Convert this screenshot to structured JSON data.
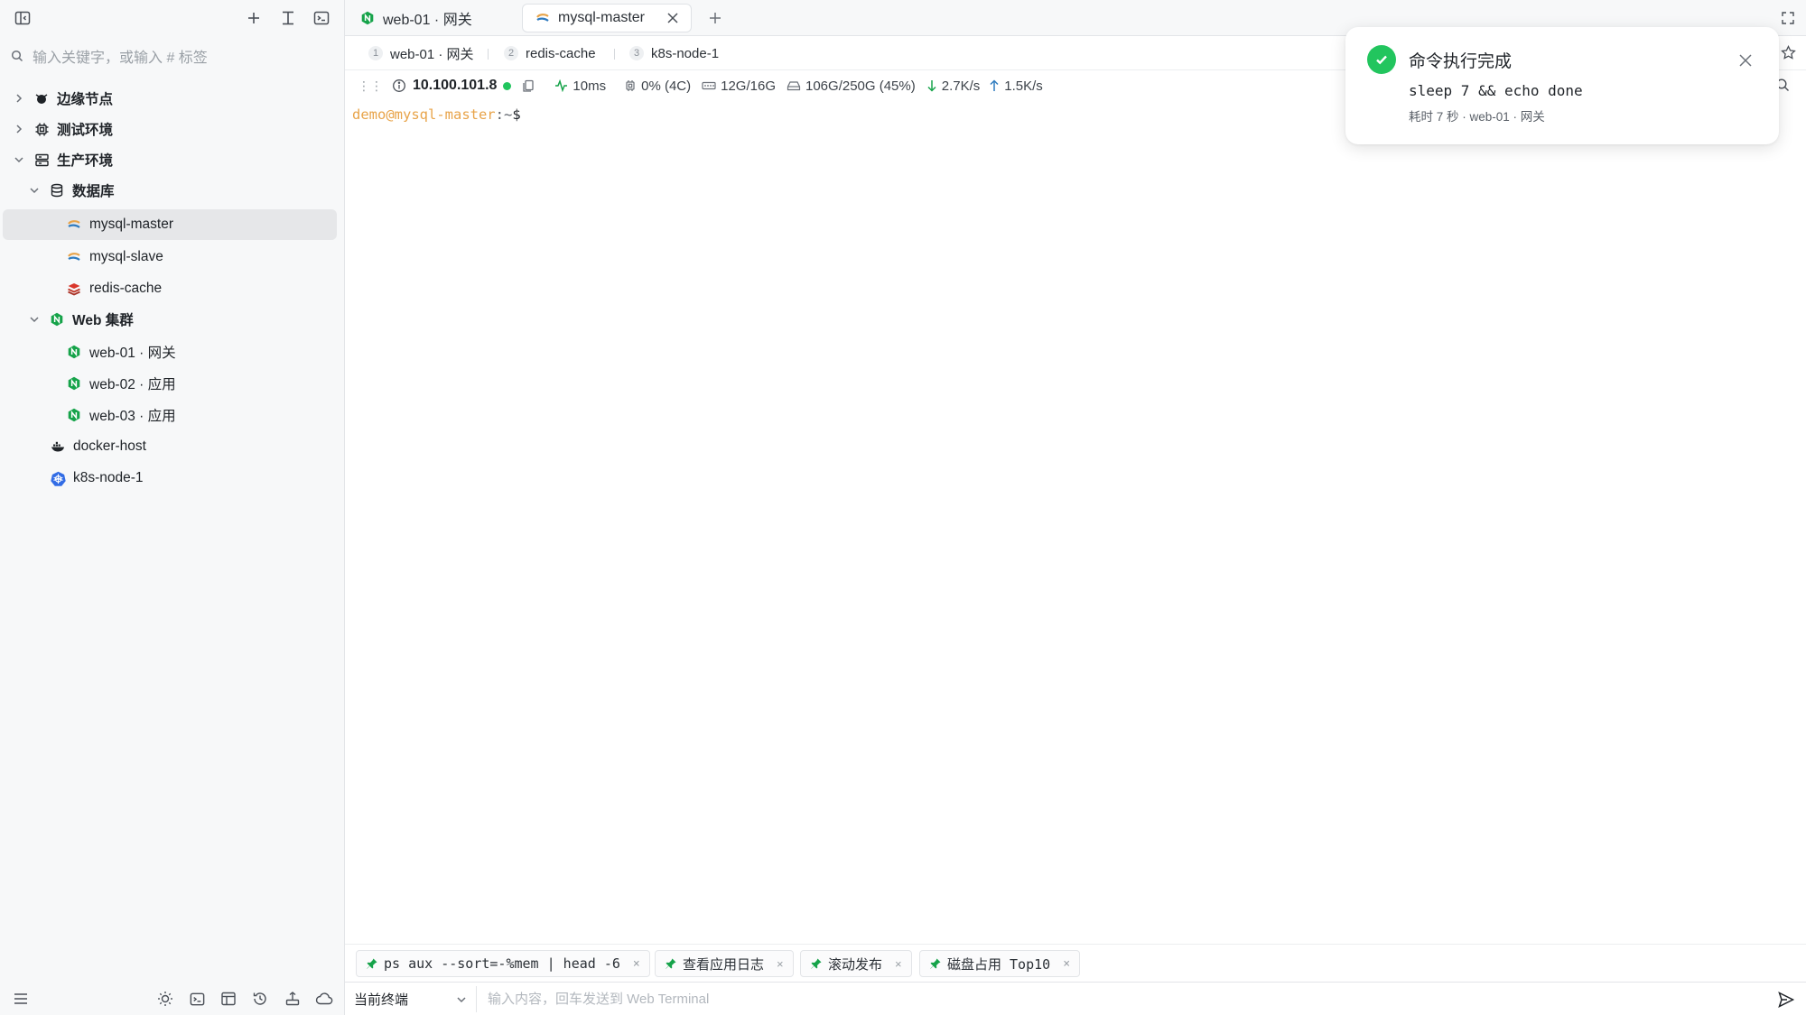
{
  "sidebar": {
    "search_placeholder": "输入关键字，或输入 # 标签",
    "tree": [
      {
        "label": "边缘节点",
        "icon": "bug-icon"
      },
      {
        "label": "测试环境",
        "icon": "chip-icon"
      },
      {
        "label": "生产环境",
        "icon": "server-icon"
      },
      {
        "label": "数据库",
        "icon": "database-icon"
      },
      {
        "label": "mysql-master",
        "icon": "mysql-icon"
      },
      {
        "label": "mysql-slave",
        "icon": "mysql-icon"
      },
      {
        "label": "redis-cache",
        "icon": "redis-icon"
      },
      {
        "label": "Web 集群",
        "icon": "nginx-icon"
      },
      {
        "label": "web-01 · 网关",
        "icon": "nginx-icon"
      },
      {
        "label": "web-02 · 应用",
        "icon": "nginx-icon"
      },
      {
        "label": "web-03 · 应用",
        "icon": "nginx-icon"
      },
      {
        "label": "docker-host",
        "icon": "docker-icon"
      },
      {
        "label": "k8s-node-1",
        "icon": "kubernetes-icon"
      }
    ]
  },
  "tabs": [
    {
      "label": "web-01 · 网关",
      "icon": "nginx-icon"
    },
    {
      "label": "mysql-master",
      "icon": "mysql-icon"
    }
  ],
  "subtabs": [
    {
      "num": "1",
      "label": "web-01 · 网关"
    },
    {
      "num": "2",
      "label": "redis-cache"
    },
    {
      "num": "3",
      "label": "k8s-node-1"
    }
  ],
  "status": {
    "host": "10.100.101.8",
    "latency": "10ms",
    "cpu": "0% (4C)",
    "mem": "12G/16G",
    "disk": "106G/250G (45%)",
    "down": "2.7K/s",
    "up": "1.5K/s"
  },
  "terminal": {
    "user": "demo@mysql-master",
    "colon": ":",
    "path": "~",
    "sign": "$"
  },
  "snippets": [
    {
      "label": "ps aux --sort=-%mem | head -6"
    },
    {
      "label": "查看应用日志"
    },
    {
      "label": "滚动发布"
    },
    {
      "label": "磁盘占用 Top10"
    }
  ],
  "snippet_close": "×",
  "input": {
    "target": "当前终端",
    "placeholder": "输入内容，回车发送到 Web Terminal"
  },
  "toast": {
    "title": "命令执行完成",
    "command": "sleep 7 && echo done",
    "meta": "耗时 7 秒 · web-01 · 网关"
  },
  "colors": {
    "accent_green": "#22c55e",
    "nginx_green": "#16a34a",
    "prompt_user": "#e8a44a",
    "active_row": "#e6e7e9"
  }
}
